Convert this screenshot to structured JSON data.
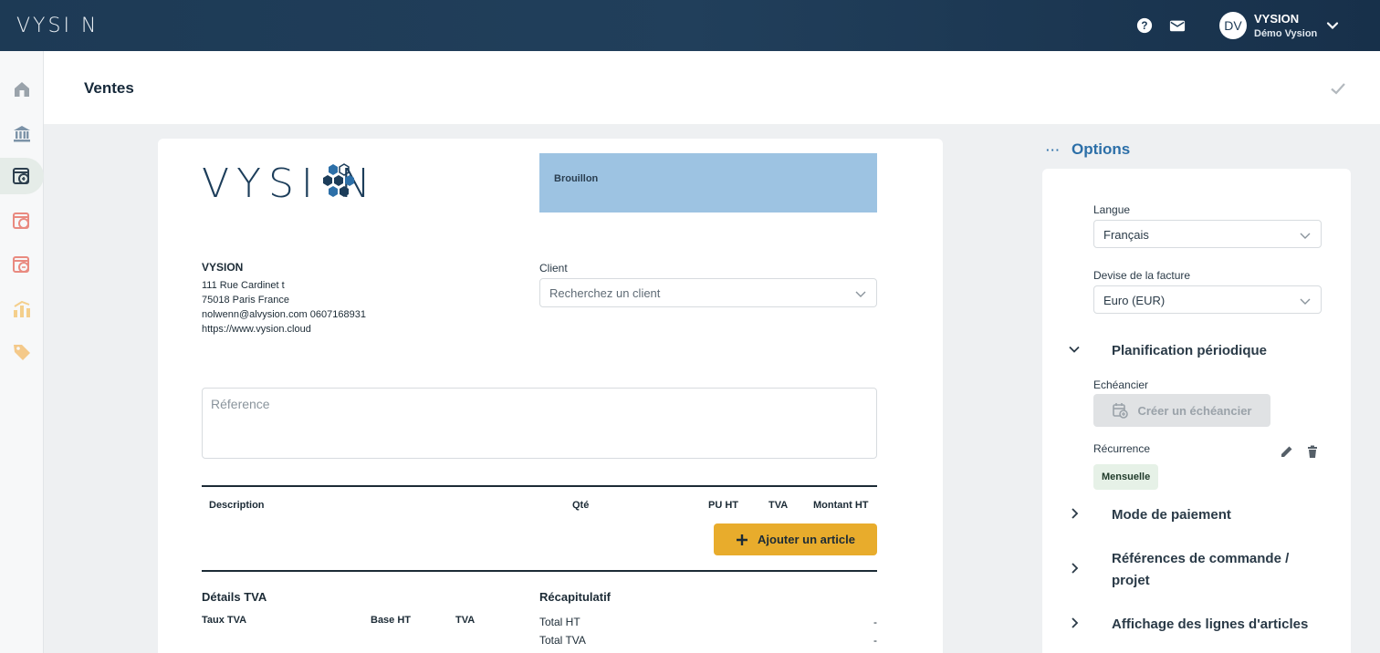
{
  "app": {
    "brand": "VYSI N",
    "user": {
      "initials": "DV",
      "name": "VYSION",
      "org": "Démo Vysion"
    }
  },
  "page": {
    "title": "Ventes"
  },
  "invoice": {
    "status": "Brouillon",
    "logo_text": "VYSI N",
    "company": {
      "name": "VYSION",
      "address1": "111 Rue Cardinet t",
      "address2": "75018 Paris France",
      "contact": "nolwenn@alvysion.com 0607168931",
      "website": "https://www.vysion.cloud"
    },
    "client": {
      "label": "Client",
      "placeholder": "Recherchez un client"
    },
    "reference_placeholder": "Réference",
    "table_headers": {
      "description": "Description",
      "qty": "Qté",
      "unit_price": "PU HT",
      "vat": "TVA",
      "amount": "Montant HT"
    },
    "add_item_label": "Ajouter un article",
    "vat_details": {
      "title": "Détails TVA",
      "col_rate": "Taux TVA",
      "col_base": "Base HT",
      "col_vat": "TVA"
    },
    "summary": {
      "title": "Récapitulatif",
      "rows": [
        {
          "label": "Total HT",
          "value": "-"
        },
        {
          "label": "Total TVA",
          "value": "-"
        }
      ]
    }
  },
  "options": {
    "title": "Options",
    "dots": "···",
    "language": {
      "label": "Langue",
      "value": "Français"
    },
    "currency": {
      "label": "Devise de la facture",
      "value": "Euro (EUR)"
    },
    "periodic": {
      "title": "Planification périodique",
      "schedule_label": "Echéancier",
      "schedule_button": "Créer un échéancier",
      "recurrence_label": "Récurrence",
      "recurrence_value": "Mensuelle"
    },
    "sections": {
      "payment": "Mode de paiement",
      "order_refs_line1": "Références de commande /",
      "order_refs_line2": "projet",
      "item_display": "Affichage des lignes d'articles"
    }
  },
  "colors": {
    "accent": "#2c6fa8",
    "add_button": "#e8ac2c",
    "status_box": "#9dc3e2",
    "topbar": "#1d3a55"
  }
}
